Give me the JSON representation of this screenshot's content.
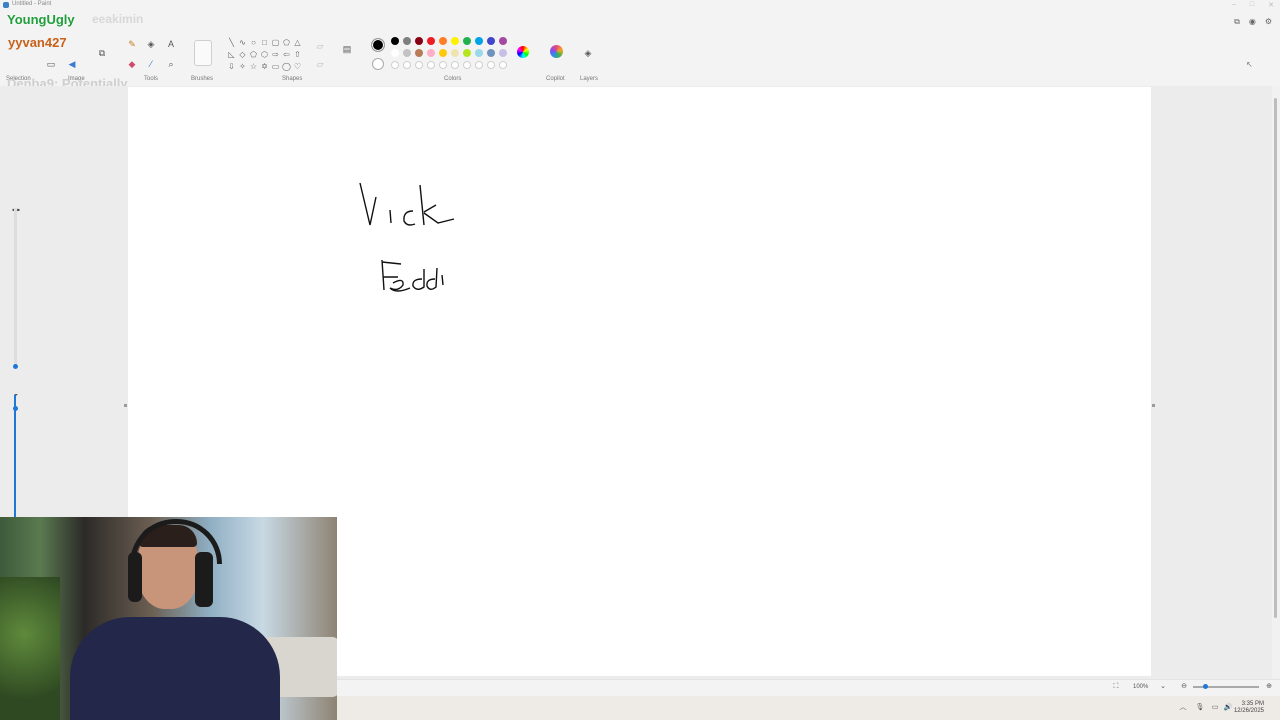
{
  "window": {
    "title": "Untitled - Paint"
  },
  "overlay": {
    "chat": [
      {
        "user": "YoungUgly",
        "message": "eeakimin"
      },
      {
        "user": "yyvan427",
        "message": ""
      },
      {
        "user": "Denba9",
        "message": "Denba9: Potentially"
      }
    ]
  },
  "ribbon": {
    "groups": {
      "selection": "Selection",
      "image": "Image",
      "tools": "Tools",
      "brushes": "Brushes",
      "shapes": "Shapes",
      "colors": "Colors",
      "copilot": "Copilot",
      "layers": "Layers"
    },
    "text_tool_glyph": "A",
    "palette_row1": [
      "#000000",
      "#7f7f7f",
      "#880015",
      "#ed1c24",
      "#ff7f27",
      "#fff200",
      "#22b14c",
      "#00a2e8",
      "#3f48cc",
      "#a349a4"
    ],
    "palette_row2": [
      "#ffffff",
      "#c3c3c3",
      "#b97a57",
      "#ffaec9",
      "#ffc90e",
      "#efe4b0",
      "#b5e61d",
      "#99d9ea",
      "#7092be",
      "#c8bfe7"
    ],
    "current_color": "#000000"
  },
  "canvas": {
    "handwriting": [
      "Vick",
      "Feddi"
    ]
  },
  "status": {
    "zoom": "100%"
  },
  "taskbar": {
    "time": "3:35 PM",
    "date": "12/26/2025"
  }
}
